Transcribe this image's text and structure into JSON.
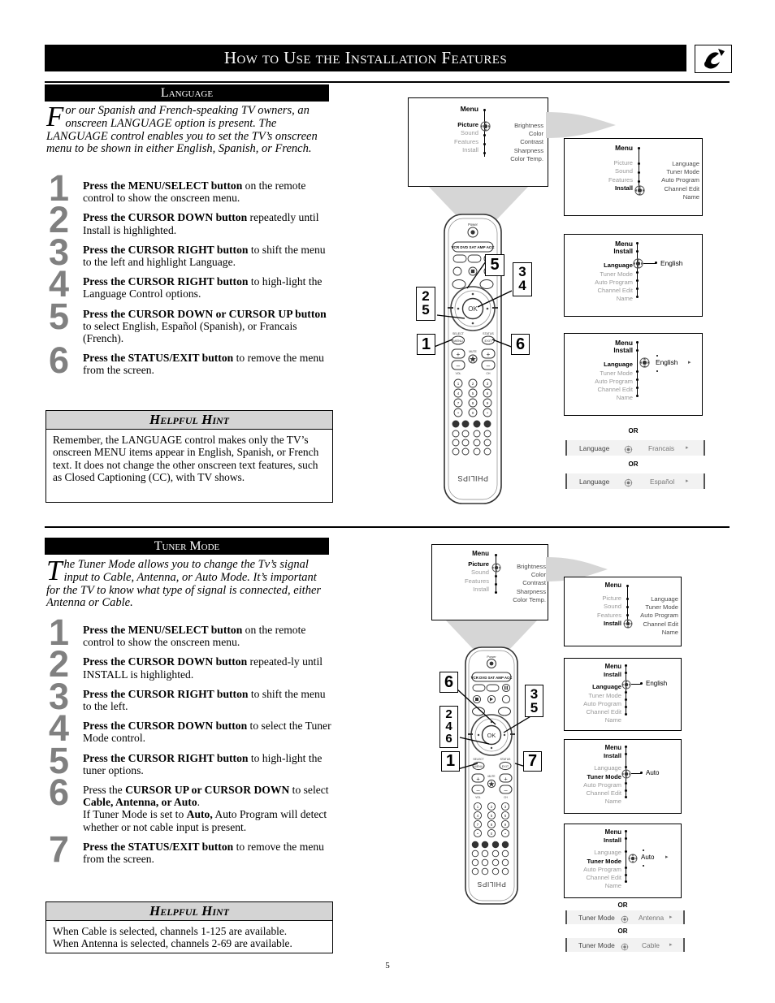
{
  "header": {
    "title": "How to Use the Installation Features",
    "icon": "satellite-dish-icon"
  },
  "page_number": "5",
  "sections": [
    {
      "id": "language",
      "title": "Language",
      "intro_dropcap": "F",
      "intro": "or our Spanish and French-speaking TV owners, an onscreen LANGUAGE option is present.  The LANGUAGE control enables you to set the TV’s onscreen menu to be shown in either English, Spanish, or French.",
      "steps": [
        {
          "num": "1",
          "bold": "Press the MENU/SELECT button",
          "rest": " on the remote control to show the onscreen menu."
        },
        {
          "num": "2",
          "bold": "Press the CURSOR DOWN button",
          "rest": " repeatedly until Install is highlighted."
        },
        {
          "num": "3",
          "bold": "Press the CURSOR RIGHT button",
          "rest": " to shift the menu to the left and highlight Language."
        },
        {
          "num": "4",
          "bold": "Press the CURSOR RIGHT button",
          "rest": " to high-light the Language Control options."
        },
        {
          "num": "5",
          "bold": "Press the CURSOR DOWN or CURSOR UP button",
          "rest": " to select English, Español (Spanish), or Francais (French)."
        },
        {
          "num": "6",
          "bold": "Press the STATUS/EXIT button",
          "rest": " to remove the menu from the screen."
        }
      ],
      "hint": {
        "title": "Helpful Hint",
        "body": "Remember, the LANGUAGE control makes only the TV’s onscreen MENU items appear in English, Spanish, or French text.  It does not change the other onscreen text features, such as Closed Captioning (CC), with TV shows."
      },
      "remote_callouts": [
        "5",
        "3\n4",
        "2\n5",
        "1",
        "6"
      ]
    },
    {
      "id": "tuner-mode",
      "title": "Tuner Mode",
      "intro_dropcap": "T",
      "intro": "he Tuner Mode allows you to change the Tv’s signal input to Cable, Antenna, or Auto Mode. It’s important for the TV to know what type of signal is connected, either Antenna or Cable.",
      "steps": [
        {
          "num": "1",
          "bold": "Press the MENU/SELECT button",
          "rest": " on the remote control to show the onscreen menu."
        },
        {
          "num": "2",
          "bold": "Press the  CURSOR DOWN button",
          "rest": " repeated-ly until INSTALL is highlighted."
        },
        {
          "num": "3",
          "bold": "Press the CURSOR RIGHT button",
          "rest": " to shift the menu to the left."
        },
        {
          "num": "4",
          "bold": "Press the CURSOR DOWN button",
          "rest": " to select the Tuner Mode control."
        },
        {
          "num": "5",
          "bold": "Press the CURSOR RIGHT button",
          "rest": " to high-light the tuner options."
        },
        {
          "num": "6",
          "pre": "Press the ",
          "bold": "CURSOR UP or CURSOR DOWN",
          "rest": " to select ",
          "bold2": "Cable, Antenna, or Auto",
          "rest2": ".",
          "extra_pre": "If Tuner Mode is set to ",
          "extra_bold": "Auto,",
          "extra_rest": " Auto Program will detect whether or not cable input is present."
        },
        {
          "num": "7",
          "bold": "Press the STATUS/EXIT button",
          "rest": " to remove the menu from the screen."
        }
      ],
      "hint": {
        "title": "Helpful Hint",
        "body": "When Cable is selected, channels 1-125 are available.\nWhen Antenna is selected, channels 2-69 are available."
      },
      "remote_callouts": [
        "6",
        "3\n5",
        "2\n4\n6",
        "1",
        "7"
      ]
    }
  ],
  "tv_screens": {
    "main_menu": {
      "title": "Menu",
      "left_items": [
        "Picture",
        "Sound",
        "Features",
        "Install"
      ],
      "highlighted": "Picture",
      "right_items": [
        "Brightness",
        "Color",
        "Contrast",
        "Sharpness",
        "Color Temp."
      ]
    },
    "install_menu": {
      "title": "Menu",
      "left_items": [
        "Picture",
        "Sound",
        "Features",
        "Install"
      ],
      "highlighted": "Install",
      "right_items": [
        "Language",
        "Tuner Mode",
        "Auto Program",
        "Channel Edit",
        "Name"
      ]
    },
    "language_selected": {
      "title": "Menu",
      "subtitle": "Install",
      "left_items": [
        "Language",
        "Tuner Mode",
        "Auto Program",
        "Channel Edit",
        "Name"
      ],
      "highlighted": "Language",
      "value": "English"
    },
    "language_options": {
      "title": "Menu",
      "subtitle": "Install",
      "left_items": [
        "Language",
        "Tuner Mode",
        "Auto Program",
        "Channel Edit",
        "Name"
      ],
      "highlighted": "Language",
      "value": "English"
    },
    "tuner_selected": {
      "title": "Menu",
      "subtitle": "Install",
      "left_items": [
        "Language",
        "Tuner Mode",
        "Auto Program",
        "Channel Edit",
        "Name"
      ],
      "highlighted": "Tuner Mode",
      "value": "Auto"
    },
    "tuner_options": {
      "title": "Menu",
      "subtitle": "Install",
      "left_items": [
        "Language",
        "Tuner Mode",
        "Auto Program",
        "Channel Edit",
        "Name"
      ],
      "highlighted": "Tuner Mode",
      "value": "Auto"
    }
  },
  "option_bars": {
    "or_label": "OR",
    "language": [
      {
        "label": "Language",
        "value": "Francais"
      },
      {
        "label": "Language",
        "value": "Español"
      }
    ],
    "tuner": [
      {
        "label": "Tuner Mode",
        "value": "Antenna"
      },
      {
        "label": "Tuner Mode",
        "value": "Cable"
      }
    ]
  },
  "remote": {
    "power_label": "Power",
    "device_row": "VCR DVD SAT AMP ACC",
    "brand": "PHILIPS",
    "ok_label": "OK",
    "select_label": "SELECT",
    "status_label": "STATUS",
    "menu_label": "MENU",
    "exit_label": "EXIT",
    "vol_label": "VOL",
    "ch_label": "CH",
    "mute_label": "MUTE"
  }
}
